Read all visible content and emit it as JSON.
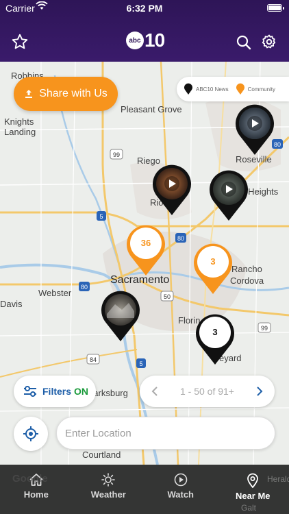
{
  "status_bar": {
    "carrier": "Carrier",
    "time": "6:32 PM"
  },
  "header": {
    "logo_abc": "abc",
    "logo_number": "10"
  },
  "map": {
    "places": [
      {
        "key": "robbins",
        "label": "Robbins"
      },
      {
        "key": "knights",
        "label": "Knights"
      },
      {
        "key": "landing",
        "label": "Landing"
      },
      {
        "key": "pleasant_grove",
        "label": "Pleasant Grove"
      },
      {
        "key": "riego",
        "label": "Riego"
      },
      {
        "key": "roseville",
        "label": "Roseville"
      },
      {
        "key": "heights",
        "label": "s Heights"
      },
      {
        "key": "rio",
        "label": "Rio"
      },
      {
        "key": "sacramento",
        "label": "Sacramento"
      },
      {
        "key": "rancho",
        "label": "Rancho"
      },
      {
        "key": "cordova",
        "label": "Cordova"
      },
      {
        "key": "davis",
        "label": "Davis"
      },
      {
        "key": "webster",
        "label": "Webster"
      },
      {
        "key": "florin",
        "label": "Florin"
      },
      {
        "key": "eyard",
        "label": "eyard"
      },
      {
        "key": "clarksburg",
        "label": "Clarksburg"
      },
      {
        "key": "courtland",
        "label": "Courtland"
      },
      {
        "key": "herald",
        "label": "Herald"
      },
      {
        "key": "galt",
        "label": "Galt"
      }
    ],
    "shields": [
      "99",
      "5",
      "80",
      "80",
      "50",
      "84",
      "5",
      "80",
      "99"
    ],
    "google_label": "Google",
    "share_button": "Share with Us",
    "legend": {
      "news": "ABC10 News",
      "community": "Community"
    },
    "pins": [
      {
        "type": "video",
        "key": "roseville_video"
      },
      {
        "type": "video",
        "key": "rio_video"
      },
      {
        "type": "video",
        "key": "heights_video"
      },
      {
        "type": "cluster_community",
        "count": "36"
      },
      {
        "type": "cluster_community",
        "count": "3"
      },
      {
        "type": "image",
        "key": "sacramento_image"
      },
      {
        "type": "cluster_news",
        "count": "3"
      }
    ],
    "filters": {
      "label": "Filters",
      "state": "ON"
    },
    "pager": {
      "text": "1 - 50 of 91+"
    },
    "location_input": {
      "placeholder": "Enter Location",
      "value": ""
    }
  },
  "tabs": [
    {
      "label": "Home",
      "icon": "home-icon"
    },
    {
      "label": "Weather",
      "icon": "sun-icon"
    },
    {
      "label": "Watch",
      "icon": "play-circle-icon"
    },
    {
      "label": "Near Me",
      "icon": "location-pin-icon",
      "active": true
    }
  ],
  "colors": {
    "header": "#2e1557",
    "accent": "#f7941d",
    "filters_on": "#1a9a3b",
    "filters": "#1d5ea8"
  }
}
